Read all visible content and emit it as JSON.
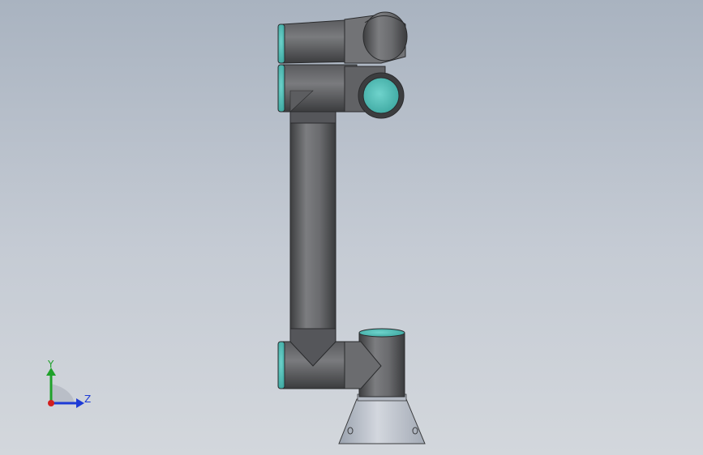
{
  "viewport": {
    "background_top": "#a9b3c0",
    "background_bottom": "#d3d7dc"
  },
  "model": {
    "name": "robot-arm",
    "colors": {
      "body_dark": "#4a4b4d",
      "body_mid": "#6a6b6e",
      "body_light": "#8d8e91",
      "joint_cap": "#5fc4bd",
      "base_light": "#c4c9d2",
      "base_mid": "#9fa6b2"
    }
  },
  "triad": {
    "y_label": "Y",
    "z_label": "Z",
    "y_color": "#1fa12a",
    "z_color": "#1d3bd6",
    "x_color": "#d21f1f"
  }
}
